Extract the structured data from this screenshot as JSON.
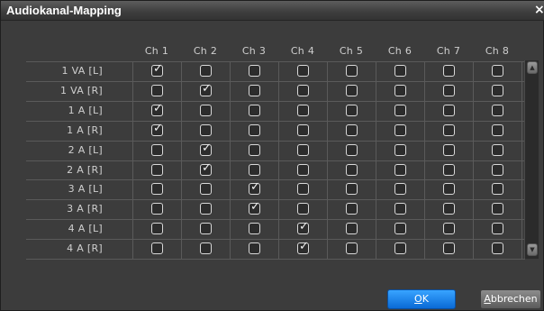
{
  "window": {
    "title": "Audiokanal-Mapping",
    "close_glyph": "×"
  },
  "channels": [
    "Ch 1",
    "Ch 2",
    "Ch 3",
    "Ch 4",
    "Ch 5",
    "Ch 6",
    "Ch 7",
    "Ch 8"
  ],
  "rows": [
    {
      "label": "1 VA [L]",
      "checked": [
        1,
        0,
        0,
        0,
        0,
        0,
        0,
        0
      ]
    },
    {
      "label": "1 VA [R]",
      "checked": [
        0,
        1,
        0,
        0,
        0,
        0,
        0,
        0
      ]
    },
    {
      "label": "1 A [L]",
      "checked": [
        1,
        0,
        0,
        0,
        0,
        0,
        0,
        0
      ]
    },
    {
      "label": "1 A [R]",
      "checked": [
        1,
        0,
        0,
        0,
        0,
        0,
        0,
        0
      ]
    },
    {
      "label": "2 A [L]",
      "checked": [
        0,
        1,
        0,
        0,
        0,
        0,
        0,
        0
      ]
    },
    {
      "label": "2 A [R]",
      "checked": [
        0,
        1,
        0,
        0,
        0,
        0,
        0,
        0
      ]
    },
    {
      "label": "3 A [L]",
      "checked": [
        0,
        0,
        1,
        0,
        0,
        0,
        0,
        0
      ]
    },
    {
      "label": "3 A [R]",
      "checked": [
        0,
        0,
        1,
        0,
        0,
        0,
        0,
        0
      ]
    },
    {
      "label": "4 A [L]",
      "checked": [
        0,
        0,
        0,
        1,
        0,
        0,
        0,
        0
      ]
    },
    {
      "label": "4 A [R]",
      "checked": [
        0,
        0,
        0,
        1,
        0,
        0,
        0,
        0
      ]
    }
  ],
  "buttons": {
    "ok_mnemonic": "O",
    "ok_rest": "K",
    "cancel_mnemonic": "A",
    "cancel_rest": "bbrechen"
  },
  "colors": {
    "accent": "#1a86f0",
    "background": "#3c3c3c",
    "gridline": "#5a5a5a"
  },
  "icons": {
    "scroll_up": "scroll-up-arrow-icon",
    "scroll_down": "scroll-down-arrow-icon",
    "check": "checkmark-icon"
  }
}
